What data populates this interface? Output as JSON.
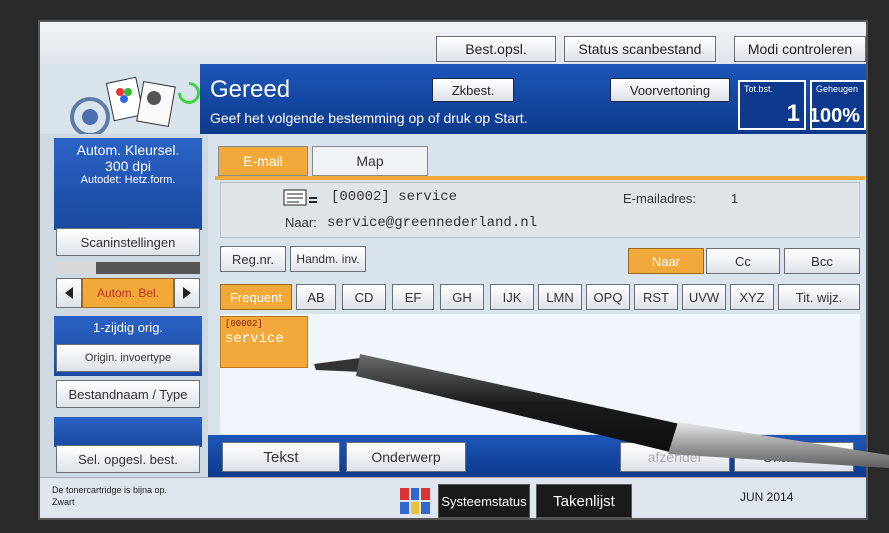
{
  "topbar": {
    "btn1": "Best.opsl.",
    "btn2": "Status scanbestand",
    "btn3": "Modi controleren"
  },
  "status": {
    "state": "Gereed",
    "message": "Geef het volgende bestemming op of druk op Start.",
    "search_btn": "Zkbest.",
    "preview_btn": "Voorvertoning",
    "counter_label": "Tot.bst.",
    "counter_value": "1",
    "memory_label": "Geheugen",
    "memory_value": "100%"
  },
  "left": {
    "color_title": "Autom. Kleursel.",
    "dpi": "300 dpi",
    "autodetect": "Autodet: Hetz.form.",
    "scan_settings": "Scaninstellingen",
    "density_label": "Autom. Bel.",
    "orig_label": "1-zijdig orig.",
    "orig_type": "Origin. invoertype",
    "filename": "Bestandnaam / Type",
    "sel_stored": "Sel. opgesl. best."
  },
  "tabs": [
    {
      "label": "E-mail"
    },
    {
      "label": "Map"
    }
  ],
  "destination": {
    "name": "[00002] service",
    "to_label": "Naar:",
    "to_value": "service@greennederland.nl",
    "count_label": "E-mailadres:",
    "count_value": "1"
  },
  "actions": {
    "reg_nr": "Reg.nr.",
    "manual": "Handm. inv.",
    "naar": "Naar",
    "cc": "Cc",
    "bcc": "Bcc"
  },
  "index_tabs": [
    "Frequent",
    "AB",
    "CD",
    "EF",
    "GH",
    "IJK",
    "LMN",
    "OPQ",
    "RST",
    "UVW",
    "XYZ",
    "Tit. wijz."
  ],
  "dest_item": {
    "code": "[00002]",
    "name": "service"
  },
  "bottom": {
    "text_btn": "Tekst",
    "subject_btn": "Onderwerp",
    "sender_btn": "afzender",
    "receipt_btn": "Ontv. Bev."
  },
  "footer": {
    "warning": "De tonercartridge is bijna op.",
    "color": "Zwart",
    "system_status": "Systeemstatus",
    "job_list": "Takenlijst",
    "date": "JUN 2014"
  }
}
